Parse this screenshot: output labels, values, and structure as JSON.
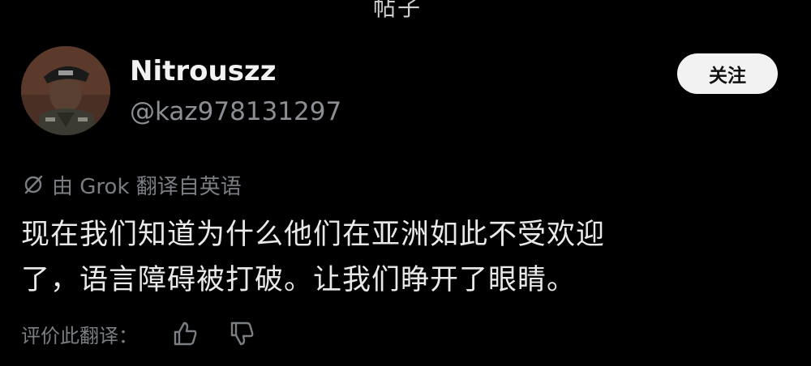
{
  "header": {
    "top_fragment": "帖子"
  },
  "author": {
    "display_name": "Nitrouszz",
    "handle": "@kaz978131297",
    "avatar_icon": "avatar-portrait"
  },
  "follow_button": {
    "label": "关注"
  },
  "translation_notice": {
    "icon": "translate-icon",
    "text": "由 Grok 翻译自英语"
  },
  "tweet": {
    "lines": [
      "现在我们知道为什么他们在亚洲如此不受欢迎",
      "了，语言障碍被打破。让我们睁开了眼睛。"
    ]
  },
  "rate_translation": {
    "label": "评价此翻译：",
    "thumb_up_icon": "thumb-up-icon",
    "thumb_down_icon": "thumb-down-icon"
  },
  "colors": {
    "background": "#000000",
    "primary_text": "#e9e9e9",
    "secondary_text": "#7a7e83",
    "button_bg": "#f2f2f2",
    "button_text": "#111111"
  }
}
